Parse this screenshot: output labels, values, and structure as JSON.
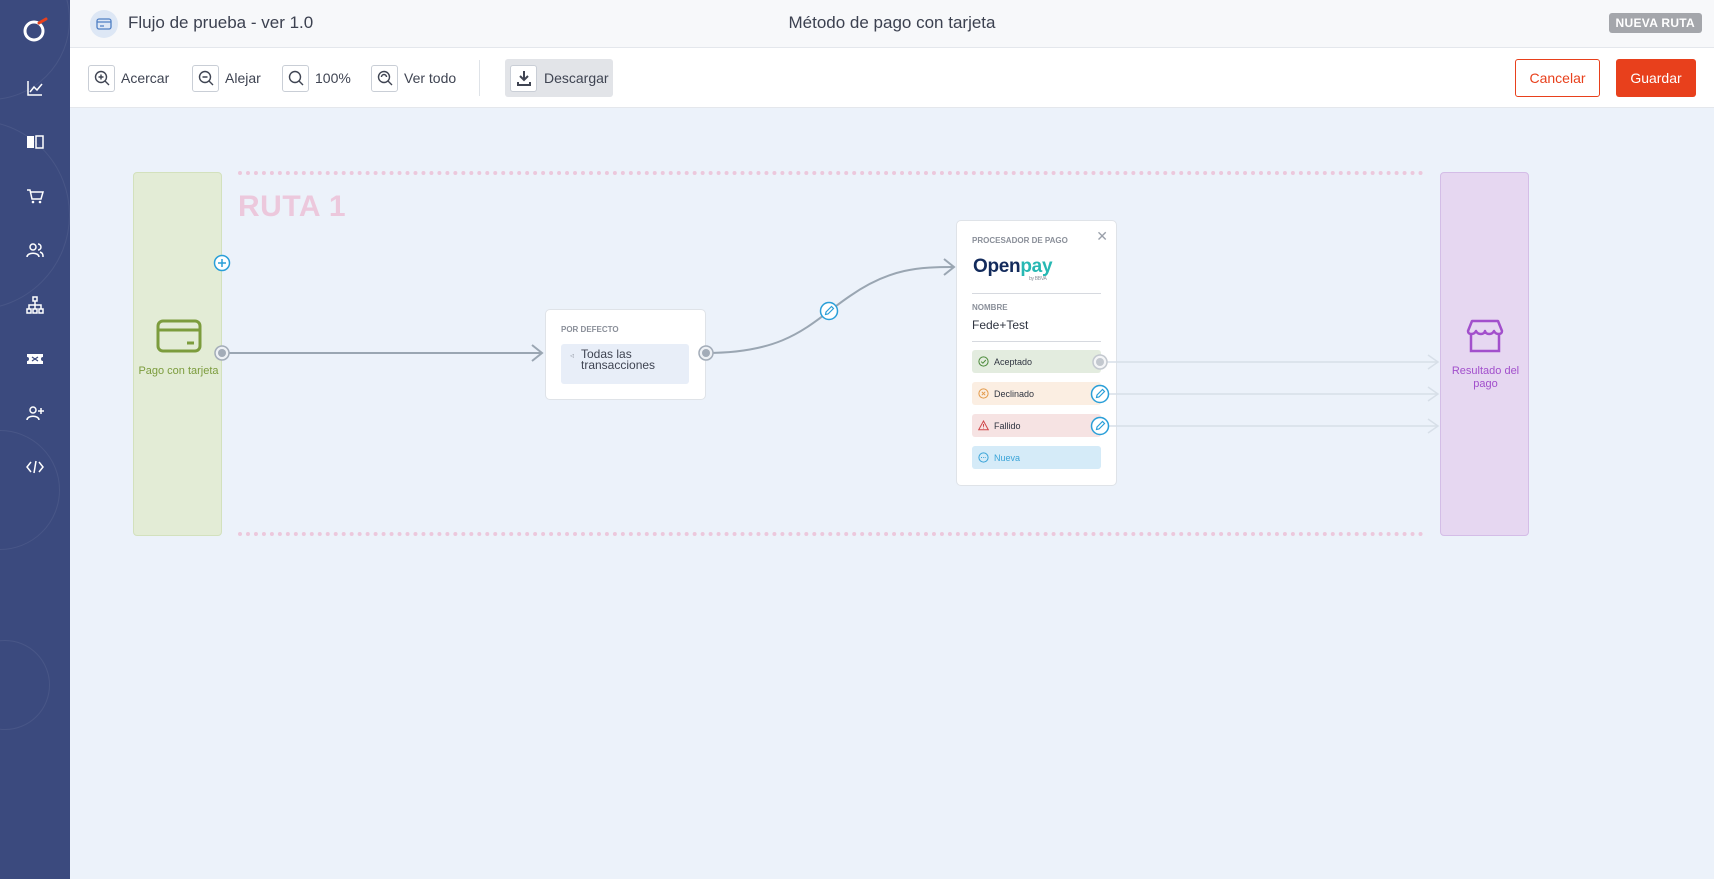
{
  "sidebar": {
    "items": [
      {
        "icon": "chart-line-icon"
      },
      {
        "icon": "book-open-icon"
      },
      {
        "icon": "cart-icon"
      },
      {
        "icon": "users-icon"
      },
      {
        "icon": "sitemap-icon"
      },
      {
        "icon": "ticket-icon"
      },
      {
        "icon": "user-plus-icon"
      },
      {
        "icon": "code-icon"
      }
    ]
  },
  "header": {
    "flow_title": "Flujo de prueba - ver 1.0",
    "page_title": "Método de pago con tarjeta",
    "badge": "NUEVA RUTA"
  },
  "toolbar": {
    "zoom_in": "Acercar",
    "zoom_out": "Alejar",
    "zoom_level": "100%",
    "fit_all": "Ver todo",
    "download": "Descargar",
    "cancel": "Cancelar",
    "save": "Guardar"
  },
  "canvas": {
    "route_label": "RUTA 1",
    "start_node": {
      "label": "Pago con tarjeta",
      "icon": "credit-card-icon"
    },
    "default_node": {
      "header": "POR DEFECTO",
      "condition": "Todas las transacciones"
    },
    "processor_node": {
      "header": "PROCESADOR DE PAGO",
      "logo_open": "O",
      "logo_pen": "pen",
      "logo_pay": "pay",
      "logo_sub": "by BBVA",
      "name_label": "NOMBRE",
      "name_value": "Fede+Test",
      "statuses": {
        "accepted": "Aceptado",
        "declined": "Declinado",
        "failed": "Fallido",
        "new": "Nueva"
      }
    },
    "end_node": {
      "label": "Resultado del pago",
      "icon": "store-icon"
    }
  },
  "colors": {
    "sidebar": "#3b4a7e",
    "accent": "#e8401c",
    "start_column": "#e3ecd6",
    "end_column": "#e6d7f1",
    "route_dashes": "#ecc8dc",
    "link_blue": "#2a9fd8"
  }
}
